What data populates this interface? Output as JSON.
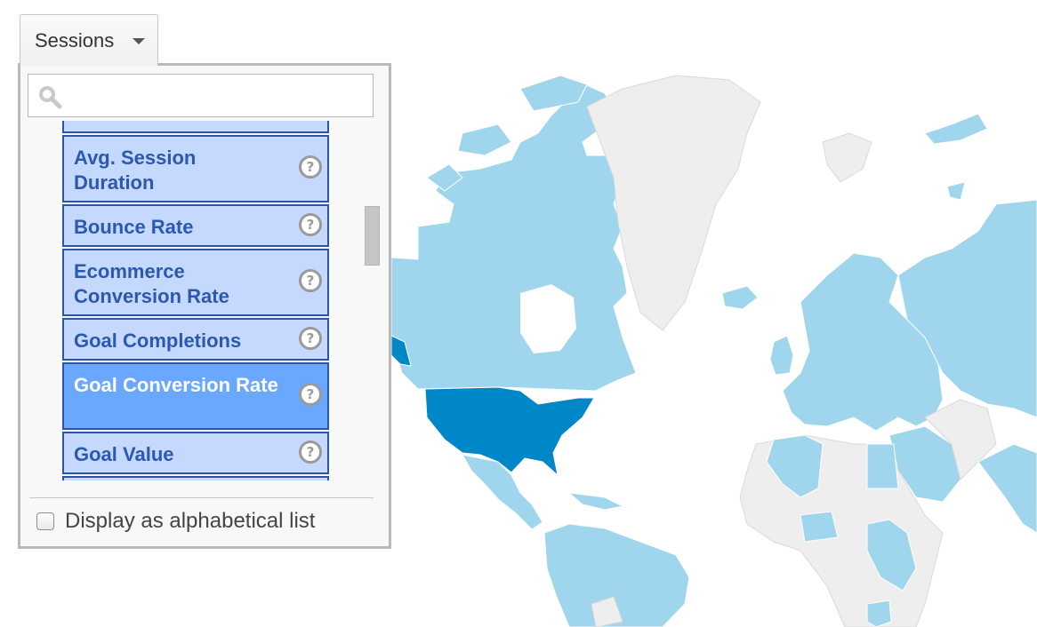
{
  "metric_selector": {
    "label": "Sessions",
    "chevron_icon": "chevron-down-icon"
  },
  "metric_panel": {
    "search": {
      "icon": "search-icon",
      "value": "",
      "placeholder": ""
    },
    "options": [
      {
        "label": "",
        "help_icon": "?",
        "selected": false,
        "partial": true
      },
      {
        "label": "Avg. Session Duration",
        "help_icon": "?",
        "selected": false
      },
      {
        "label": "Bounce Rate",
        "help_icon": "?",
        "selected": false
      },
      {
        "label": "Ecommerce Conversion Rate",
        "help_icon": "?",
        "selected": false
      },
      {
        "label": "Goal Completions",
        "help_icon": "?",
        "selected": false
      },
      {
        "label": "Goal Conversion Rate",
        "help_icon": "?",
        "selected": true
      },
      {
        "label": "Goal Value",
        "help_icon": "?",
        "selected": false
      },
      {
        "label": "",
        "help_icon": "",
        "selected": false,
        "partial": true
      }
    ],
    "alphabetical_toggle": {
      "label": "Display as alphabetical list",
      "checked": false
    }
  },
  "map": {
    "colors": {
      "highlight": "#0087c8",
      "data": "#9fd6ee",
      "no_data": "#eeeeee",
      "border": "#ffffff"
    }
  }
}
